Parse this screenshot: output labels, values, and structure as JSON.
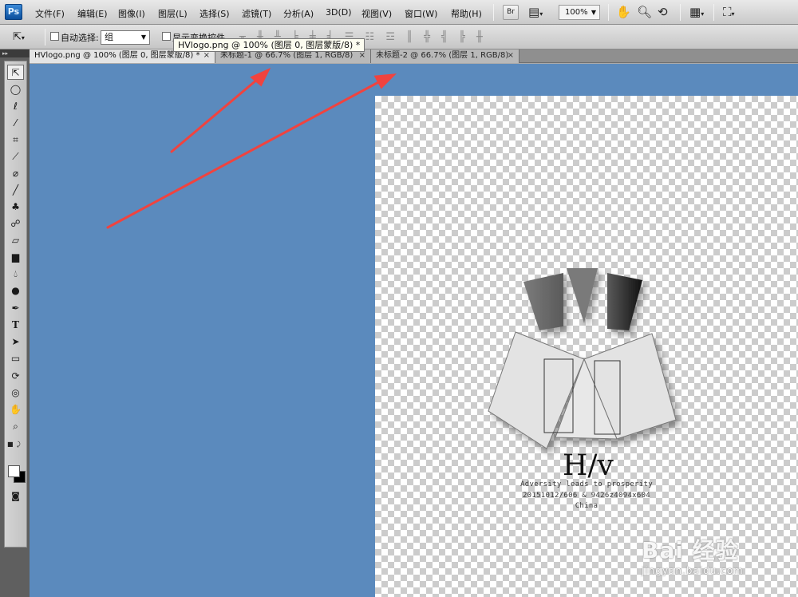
{
  "app": {
    "logo": "Ps",
    "menu": [
      "文件(F)",
      "编辑(E)",
      "图像(I)",
      "图层(L)",
      "选择(S)",
      "滤镜(T)",
      "分析(A)",
      "3D(D)",
      "视图(V)",
      "窗口(W)",
      "帮助(H)"
    ],
    "bridge_label": "Br",
    "zoom_level": "100%"
  },
  "options": {
    "auto_select_label": "自动选择:",
    "auto_select_value": "组",
    "show_transform_label": "显示变换控件"
  },
  "tooltip": "HVlogo.png @ 100% (图层 0, 图层蒙版/8) *",
  "tabs": [
    {
      "label": "HVlogo.png @ 100% (图层 0, 图层蒙版/8) *"
    },
    {
      "label": "未标题-1 @ 66.7% (图层 1, RGB/8)"
    },
    {
      "label": "未标题-2 @ 66.7% (图层 1, RGB/8)"
    }
  ],
  "canvas": {
    "logo_title": "H/v",
    "logo_line1": "Adversity leads to prosperity",
    "logo_line2": "20151012/606 & 9426z4094x604",
    "logo_line3": "China"
  },
  "watermark": {
    "main": "Bai 经验",
    "sub": "jingyan.baidu.com"
  },
  "colors": {
    "workspace": "#5b8abd",
    "arrow": "#f0433f",
    "foreground": "#ffffff",
    "background": "#000000"
  },
  "icons": {
    "tools": [
      "move-tool",
      "elliptical-marquee-tool",
      "lasso-tool",
      "magic-wand-tool",
      "crop-tool",
      "eyedropper-tool",
      "healing-brush-tool",
      "brush-tool",
      "clone-stamp-tool",
      "history-brush-tool",
      "eraser-tool",
      "gradient-tool",
      "blur-tool",
      "dodge-tool",
      "pen-tool",
      "type-tool",
      "path-selection-tool",
      "rectangle-tool",
      "3d-rotate-tool",
      "3d-orbit-tool",
      "hand-tool",
      "zoom-tool"
    ]
  }
}
